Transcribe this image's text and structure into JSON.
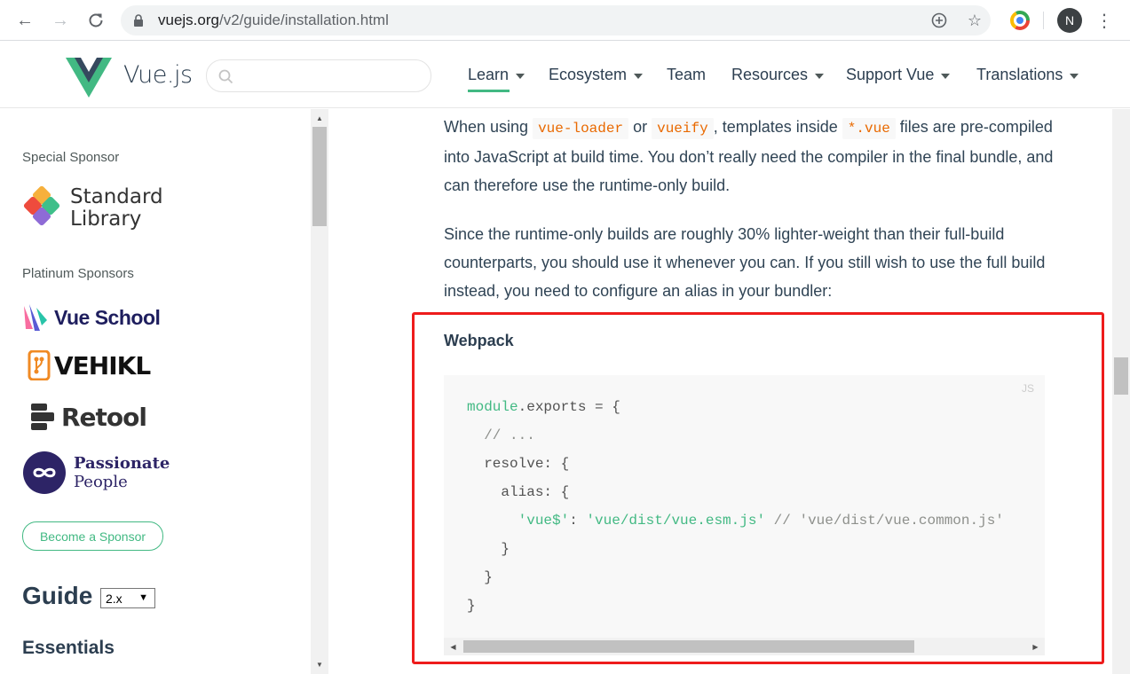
{
  "browser": {
    "url_host": "vuejs.org",
    "url_path": "/v2/guide/installation.html",
    "avatar_letter": "N"
  },
  "header": {
    "site_name": "Vue.js",
    "search": {
      "value": "",
      "placeholder": ""
    },
    "nav": [
      {
        "label": "Learn",
        "has_caret": true,
        "active": true
      },
      {
        "label": "Ecosystem",
        "has_caret": true
      },
      {
        "label": "Team",
        "has_caret": false
      },
      {
        "label": "Resources",
        "has_caret": true
      },
      {
        "label": "Support Vue",
        "has_caret": true
      },
      {
        "label": "Translations",
        "has_caret": true
      }
    ]
  },
  "sidebar": {
    "special_sponsor_label": "Special Sponsor",
    "special_sponsor": {
      "line1": "Standard",
      "line2": "Library"
    },
    "platinum_label": "Platinum Sponsors",
    "platinum": [
      {
        "name": "Vue School"
      },
      {
        "name": "VEHIKL"
      },
      {
        "name": "Retool"
      },
      {
        "line1": "Passionate",
        "line2": "People"
      }
    ],
    "become_sponsor": "Become a Sponsor",
    "guide_title": "Guide",
    "version": "2.x",
    "section": "Essentials"
  },
  "content": {
    "para1": {
      "t1": "When using ",
      "c1": "vue-loader",
      "t2": " or ",
      "c2": "vueify",
      "t3": ", templates inside ",
      "c3": "*.vue",
      "t4": " files are pre-compiled into JavaScript at build time. You don’t really need the compiler in the final bundle, and can therefore use the runtime-only build."
    },
    "para2": "Since the runtime-only builds are roughly 30% lighter-weight than their full-build counterparts, you should use it whenever you can. If you still wish to use the full build instead, you need to configure an alias in your bundler:",
    "subheading": "Webpack",
    "code_lang": "JS",
    "code": {
      "l1a": "module",
      "l1b": ".exports = {",
      "l2": "  // ...",
      "l3": "  resolve: {",
      "l4": "    alias: {",
      "l5a": "      'vue$'",
      "l5b": ": ",
      "l5c": "'vue/dist/vue.esm.js'",
      "l5d": " // 'vue/dist/vue.common.js'",
      "l6": "    }",
      "l7": "  }",
      "l8": "}"
    }
  },
  "colors": {
    "accent": "#42b983",
    "highlight_box": "#ee1c1c",
    "inline_code": "#e96900"
  }
}
